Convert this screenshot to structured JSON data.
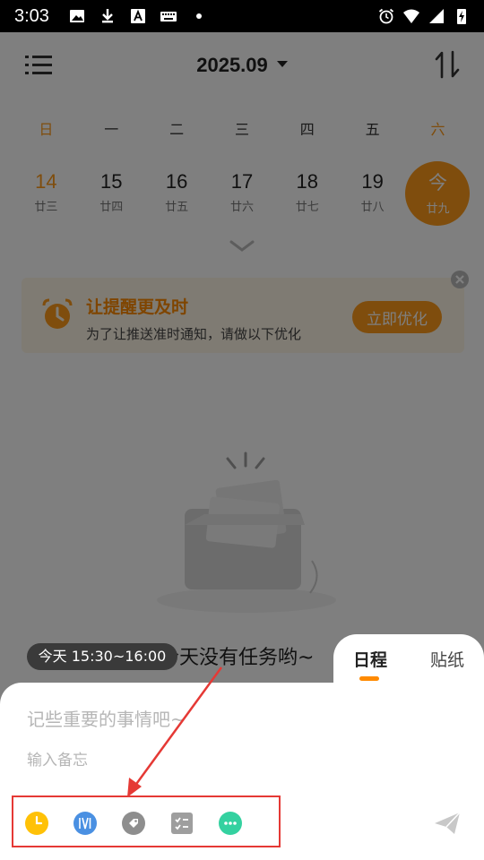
{
  "status_bar": {
    "time": "3:03",
    "left_icons": [
      "image-icon",
      "download-icon",
      "font-icon",
      "keyboard-icon",
      "dot-icon"
    ],
    "right_icons": [
      "alarm-icon",
      "wifi-icon",
      "signal-icon",
      "battery-charging-icon"
    ]
  },
  "header": {
    "month": "2025.09",
    "menu_icon": "list-icon",
    "sort_icon": "sort-icon"
  },
  "week": {
    "days": [
      "日",
      "一",
      "二",
      "三",
      "四",
      "五",
      "六"
    ],
    "dates": [
      {
        "num": "14",
        "lunar": "廿三"
      },
      {
        "num": "15",
        "lunar": "廿四"
      },
      {
        "num": "16",
        "lunar": "廿五"
      },
      {
        "num": "17",
        "lunar": "廿六"
      },
      {
        "num": "18",
        "lunar": "廿七"
      },
      {
        "num": "19",
        "lunar": "廿八"
      },
      {
        "num": "今",
        "lunar": "廿九"
      }
    ]
  },
  "reminder": {
    "title": "让提醒更及时",
    "desc": "为了让推送准时通知，请做以下优化",
    "button": "立即优化"
  },
  "empty_state": {
    "text": "今天没有任务哟~"
  },
  "composer": {
    "time_chip": "今天 15:30~16:00",
    "tabs": [
      "日程",
      "贴纸"
    ],
    "title_placeholder": "记些重要的事情吧~",
    "memo_placeholder": "输入备忘",
    "tools": [
      "clock-icon",
      "priority-icon",
      "tag-icon",
      "checklist-icon",
      "more-icon"
    ],
    "send_icon": "send-icon"
  },
  "colors": {
    "accent": "#ff9b1a",
    "highlight_box": "#e53935",
    "clock_tool": "#ffc107",
    "priority_tool": "#4a90e2",
    "tag_tool": "#8e8e8e",
    "checklist_tool": "#9e9e9e",
    "more_tool": "#34d1a0"
  }
}
